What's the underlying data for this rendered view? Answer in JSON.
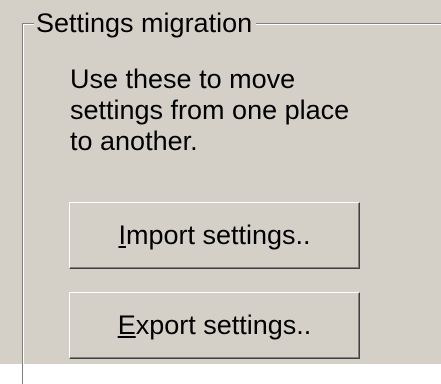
{
  "group": {
    "title": "Settings migration",
    "description_lines": [
      "Use these to move",
      "settings from one place",
      "to another."
    ]
  },
  "buttons": {
    "import": {
      "mnemonic": "I",
      "rest": "mport settings.."
    },
    "export": {
      "mnemonic": "E",
      "rest": "xport settings.."
    }
  },
  "colors": {
    "face": "#d4d0c8",
    "shadow": "#808080",
    "dark_shadow": "#404040",
    "highlight": "#ffffff"
  }
}
